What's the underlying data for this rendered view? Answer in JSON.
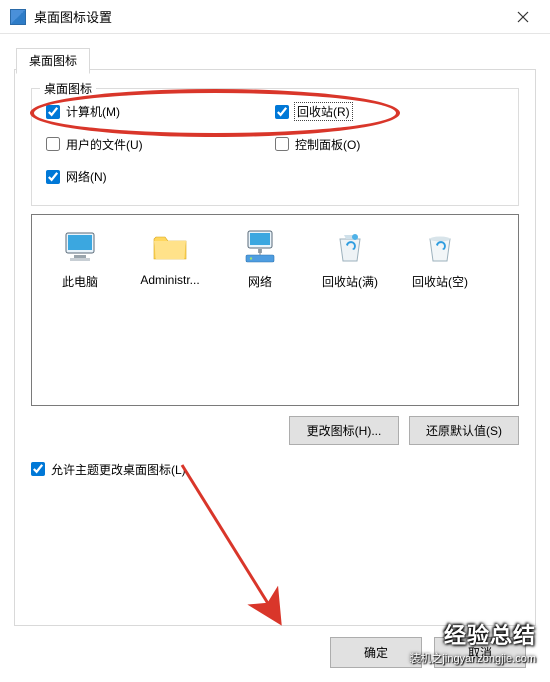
{
  "window": {
    "title": "桌面图标设置"
  },
  "tab": {
    "label": "桌面图标"
  },
  "group": {
    "title": "桌面图标",
    "items": {
      "computer": {
        "label": "计算机(M)",
        "checked": true
      },
      "recycle": {
        "label": "回收站(R)",
        "checked": true
      },
      "userfiles": {
        "label": "用户的文件(U)",
        "checked": false
      },
      "cpanel": {
        "label": "控制面板(O)",
        "checked": false
      },
      "network": {
        "label": "网络(N)",
        "checked": true
      }
    }
  },
  "icons": [
    {
      "id": "this-pc",
      "label": "此电脑"
    },
    {
      "id": "admin",
      "label": "Administr..."
    },
    {
      "id": "network",
      "label": "网络"
    },
    {
      "id": "recycle-full",
      "label": "回收站(满)"
    },
    {
      "id": "recycle-empty",
      "label": "回收站(空)"
    }
  ],
  "buttons": {
    "change_icon": "更改图标(H)...",
    "restore_default": "还原默认值(S)"
  },
  "allow_theme": {
    "label": "允许主题更改桌面图标(L)",
    "checked": true
  },
  "dialog": {
    "ok": "确定",
    "cancel": "取消"
  },
  "watermark": {
    "line1": "经验总结",
    "line2": "装机之jingyanzongjie.com"
  }
}
